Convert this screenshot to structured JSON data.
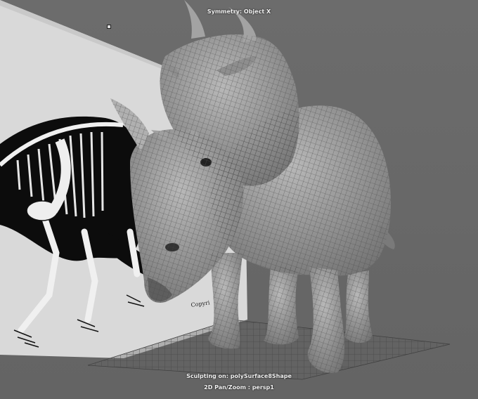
{
  "viewport": {
    "symmetry_label": "Symmetry: Object X",
    "sculpt_label": "Sculpting on: polySurface8Shape",
    "panzoom_label": "2D Pan/Zoom : persp1"
  },
  "image_plane": {
    "subject": "dinosaur skeleton reference drawing",
    "copyright_text": "Copyri"
  },
  "model": {
    "subject": "horned dinosaur sculpt with quad wireframe",
    "icon": "centrosaur-model-icon"
  },
  "colors": {
    "viewport_bg": "#6a6a6a",
    "hud_text": "#f2f2f2",
    "mesh_fill": "#9a9a9a",
    "wire": "#4a4a4a"
  }
}
